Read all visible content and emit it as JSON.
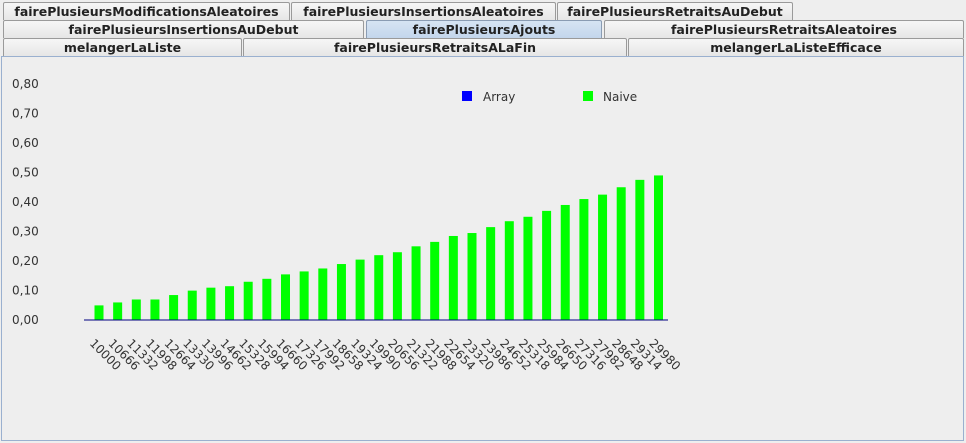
{
  "tabs": {
    "row1": [
      {
        "label": "fairePlusieursModificationsAleatoires"
      },
      {
        "label": "fairePlusieursInsertionsAleatoires"
      },
      {
        "label": "fairePlusieursRetraitsAuDebut"
      }
    ],
    "row2": [
      {
        "label": "fairePlusieursInsertionsAuDebut"
      },
      {
        "label": "fairePlusieursAjouts"
      },
      {
        "label": "fairePlusieursRetraitsAleatoires"
      }
    ],
    "row3": [
      {
        "label": "melangerLaListe"
      },
      {
        "label": "fairePlusieursRetraitsALaFin"
      },
      {
        "label": "melangerLaListeEfficace"
      }
    ],
    "selected": "fairePlusieursAjouts"
  },
  "colors": {
    "array": "#0000ff",
    "naive": "#00ff00",
    "axis": "#000080"
  },
  "chart_data": {
    "type": "bar",
    "categories": [
      "10000",
      "10666",
      "11332",
      "11998",
      "12664",
      "13330",
      "13996",
      "14662",
      "15328",
      "15994",
      "16660",
      "17326",
      "17992",
      "18658",
      "19324",
      "19990",
      "20656",
      "21322",
      "21988",
      "22654",
      "23320",
      "23986",
      "24652",
      "25318",
      "25984",
      "26650",
      "27316",
      "27982",
      "28648",
      "29314",
      "29980"
    ],
    "series": [
      {
        "name": "Array",
        "values": [
          0,
          0,
          0,
          0,
          0,
          0,
          0,
          0,
          0,
          0,
          0,
          0,
          0,
          0,
          0,
          0,
          0,
          0,
          0,
          0,
          0,
          0,
          0,
          0,
          0,
          0,
          0,
          0,
          0,
          0,
          0
        ]
      },
      {
        "name": "Naive",
        "values": [
          0.05,
          0.06,
          0.07,
          0.07,
          0.085,
          0.1,
          0.11,
          0.115,
          0.13,
          0.14,
          0.155,
          0.165,
          0.175,
          0.19,
          0.205,
          0.22,
          0.23,
          0.25,
          0.265,
          0.285,
          0.295,
          0.315,
          0.335,
          0.35,
          0.37,
          0.39,
          0.41,
          0.425,
          0.45,
          0.475,
          0.49
        ]
      }
    ],
    "yticks": [
      "0,00",
      "0,10",
      "0,20",
      "0,30",
      "0,40",
      "0,50",
      "0,60",
      "0,70",
      "0,80"
    ],
    "ylim": [
      -0.013,
      0.83
    ],
    "legend_position": "top-right",
    "grid": false
  }
}
